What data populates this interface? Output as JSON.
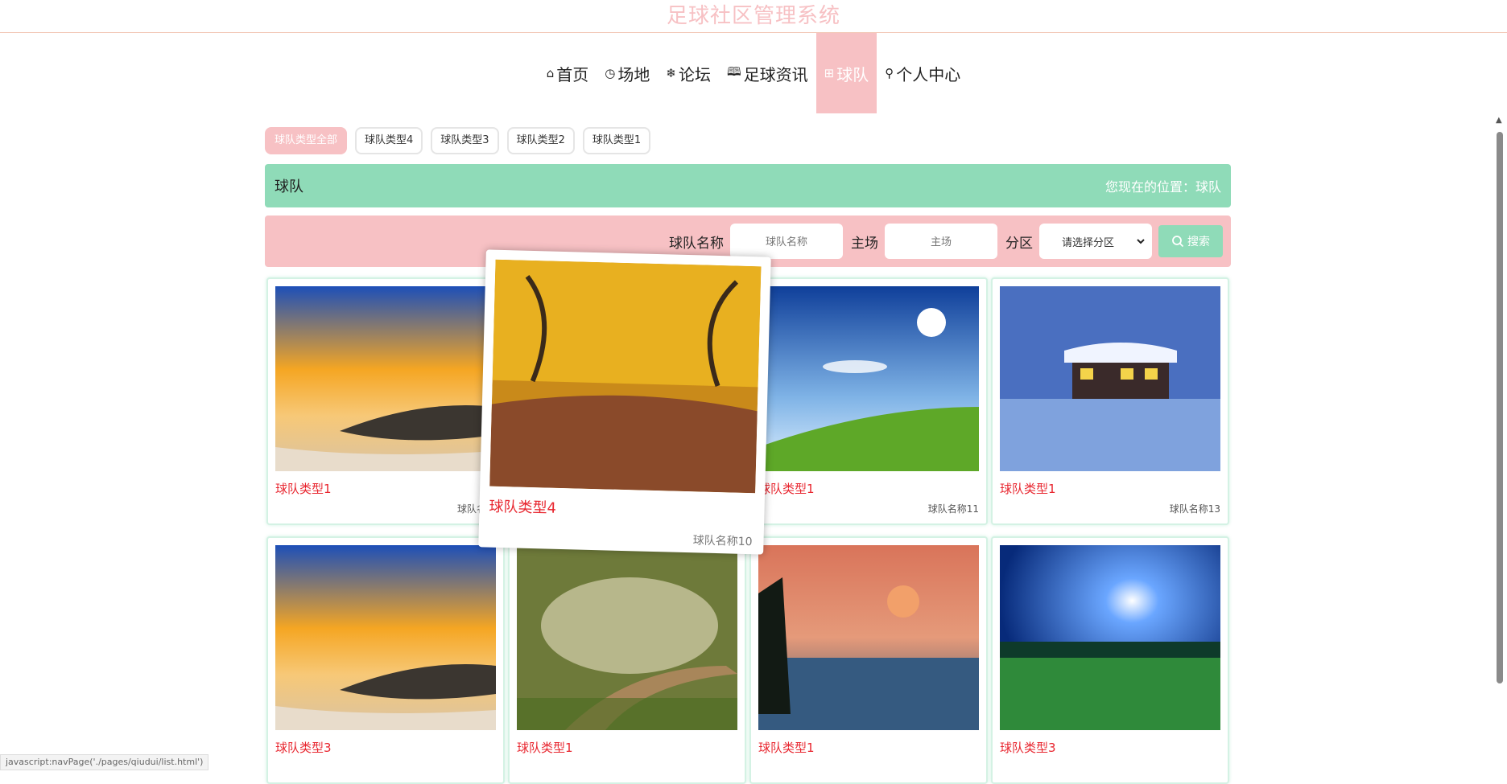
{
  "header": {
    "title": "足球社区管理系统"
  },
  "nav": [
    {
      "icon": "home-icon",
      "glyph": "⌂",
      "label": "首页"
    },
    {
      "icon": "clock-icon",
      "glyph": "◷",
      "label": "场地"
    },
    {
      "icon": "snowflake-icon",
      "glyph": "❄",
      "label": "论坛"
    },
    {
      "icon": "book-icon",
      "glyph": "🕮",
      "label": "足球资讯"
    },
    {
      "icon": "grid-icon",
      "glyph": "⊞",
      "label": "球队"
    },
    {
      "icon": "user-icon",
      "glyph": "⚲",
      "label": "个人中心"
    }
  ],
  "type_filters": [
    "球队类型全部",
    "球队类型4",
    "球队类型3",
    "球队类型2",
    "球队类型1"
  ],
  "section": {
    "title": "球队",
    "location": "您现在的位置：球队"
  },
  "search": {
    "name_label": "球队名称",
    "name_placeholder": "球队名称",
    "venue_label": "主场",
    "venue_placeholder": "主场",
    "zone_label": "分区",
    "zone_selected": "请选择分区",
    "button_label": "搜索"
  },
  "cards": [
    {
      "type": "球队类型1",
      "name": "球队名称",
      "image": "sunset-beach"
    },
    {
      "type": "球队类型4",
      "name": "球队名称10",
      "image": "autumn-trees"
    },
    {
      "type": "球队类型1",
      "name": "球队名称11",
      "image": "blue-sky-meadow"
    },
    {
      "type": "球队类型1",
      "name": "球队名称13",
      "image": "snow-cabin"
    },
    {
      "type": "球队类型3",
      "name": "",
      "image": "sunset-beach"
    },
    {
      "type": "球队类型1",
      "name": "",
      "image": "forest-path"
    },
    {
      "type": "球队类型1",
      "name": "",
      "image": "moon-lake"
    },
    {
      "type": "球队类型3",
      "name": "",
      "image": "night-field"
    }
  ],
  "status_bar": "javascript:navPage('./pages/qiudui/list.html')",
  "colors": {
    "accent_pink": "#f7c1c4",
    "accent_green": "#8fdbb8",
    "type_red": "#e8262f"
  }
}
